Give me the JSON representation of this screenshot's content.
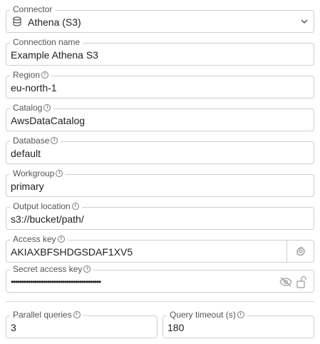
{
  "connector": {
    "label": "Connector",
    "value": "Athena (S3)"
  },
  "connection_name": {
    "label": "Connection name",
    "value": "Example Athena S3"
  },
  "region": {
    "label": "Region",
    "value": "eu-north-1"
  },
  "catalog": {
    "label": "Catalog",
    "value": "AwsDataCatalog"
  },
  "database": {
    "label": "Database",
    "value": "default"
  },
  "workgroup": {
    "label": "Workgroup",
    "value": "primary"
  },
  "output_location": {
    "label": "Output location",
    "value": "s3://bucket/path/"
  },
  "access_key": {
    "label": "Access key",
    "value": "AKIAXBFSHDGSDAF1XV5"
  },
  "secret_access_key": {
    "label": "Secret access key",
    "value": "••••••••••••••••••••••••••••••••••••••••••"
  },
  "parallel_queries": {
    "label": "Parallel queries",
    "value": "3"
  },
  "query_timeout": {
    "label": "Query timeout (s)",
    "value": "180"
  },
  "info_glyph": "i",
  "icons": [
    "database-icon",
    "chevron-down-icon",
    "info-icon",
    "gear-icon",
    "eye-off-icon",
    "unlock-icon"
  ]
}
